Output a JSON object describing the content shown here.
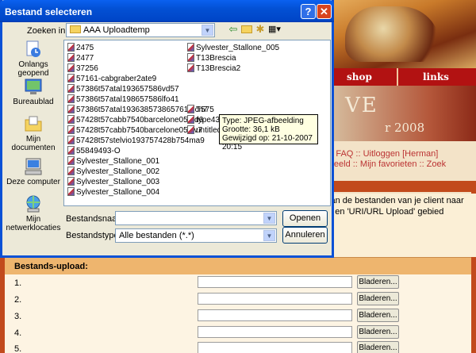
{
  "dialog": {
    "title": "Bestand selecteren",
    "help_glyph": "?",
    "close_glyph": "✕",
    "look_in_label": "Zoeken in:",
    "look_in_value": "AAA Uploadtemp",
    "places": [
      {
        "label": "Onlangs geopend",
        "icon": "recent-documents-icon"
      },
      {
        "label": "Bureaublad",
        "icon": "desktop-icon"
      },
      {
        "label": "Mijn documenten",
        "icon": "my-documents-icon"
      },
      {
        "label": "Deze computer",
        "icon": "my-computer-icon"
      },
      {
        "label": "Mijn netwerklocaties",
        "icon": "network-places-icon"
      }
    ],
    "files_col1": [
      "2475",
      "2477",
      "37256",
      "57161-cabgraber2ate9",
      "57386t57atal193657586vd57",
      "57386t57atal198657586lfo41",
      "57386t57atal193638573865761 8cn7",
      "57428t57cabb7540barcelone05btd6",
      "57428t57cabb7540barcelone05cfv7",
      "57428t57stelvio193757428b754ma9",
      "55849493-O",
      "Sylvester_Stallone_001",
      "Sylvester_Stallone_002",
      "Sylvester_Stallone_003",
      "Sylvester_Stallone_004"
    ],
    "files_col2": [
      "Sylvester_Stallone_005",
      "T13Brescia",
      "T13Brescia2",
      "T575",
      "type43 grand sport",
      "untitled9999999"
    ],
    "tooltip": {
      "type": "Type: JPEG-afbeelding",
      "size": "Grootte: 36,1 kB",
      "modified": "Gewijzigd op: 21-10-2007 20:15"
    },
    "filename_label": "Bestandsnaam:",
    "filename_value": "",
    "filetype_label": "Bestandstypen:",
    "filetype_value": "Alle bestanden (*.*)",
    "open_label": "Openen",
    "cancel_label": "Annuleren"
  },
  "page": {
    "nav": [
      "shop",
      "links"
    ],
    "title_letters": "VE",
    "title_year": "r 2008",
    "links_line1": "d :: FAQ :: Uitloggen [Herman]",
    "links_line2": "ordeeld :: Mijn favorieten :: Zoek",
    "info_line1": "van de bestanden van je client naar",
    "info_line2": "d' en 'URI/URL Upload' gebied",
    "info_line3": ":",
    "upload_header": "Bestands-upload:",
    "upload_rows": [
      "1.",
      "2.",
      "3.",
      "4.",
      "5."
    ],
    "browse_label": "Bladeren..."
  }
}
